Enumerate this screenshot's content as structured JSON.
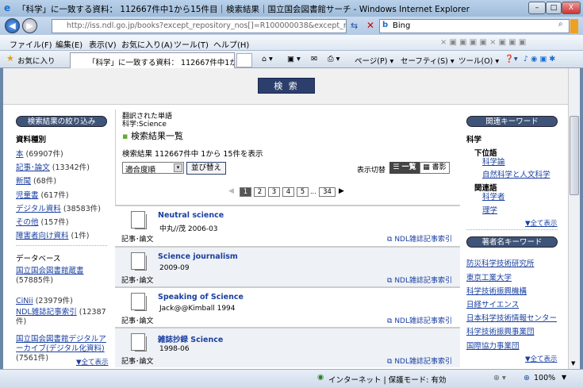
{
  "window": {
    "title": "「科学」に一致する資料： 112667件中1から15件目｜検索結果｜国立国会図書館サーチ - Windows Internet Explorer",
    "minimize": "–",
    "maximize": "□",
    "close": "X"
  },
  "address": {
    "url": "http://iss.ndl.go.jp/books?except_repository_nos[]=R100000038&except_reposito",
    "search_placeholder": "Bing"
  },
  "menu": [
    "ファイル(F)",
    "編集(E)",
    "表示(V)",
    "お気に入り(A)",
    "ツール(T)",
    "ヘルプ(H)"
  ],
  "favorites": {
    "label": "お気に入り",
    "tab": "「科学」に一致する資料： 112667件中1から1...",
    "tools": [
      "ページ(P) ▾",
      "セーフティ(S) ▾",
      "ツール(O) ▾"
    ]
  },
  "search_button": "検 索",
  "left": {
    "header": "検索結果の絞り込み",
    "type_title": "資料種別",
    "types": [
      {
        "label": "本",
        "count": "(69907件)"
      },
      {
        "label": "記事･論文",
        "count": "(13342件)"
      },
      {
        "label": "新聞",
        "count": "(68件)"
      },
      {
        "label": "児童書",
        "count": "(617件)"
      },
      {
        "label": "デジタル資料",
        "count": "(38583件)"
      },
      {
        "label": "その他",
        "count": "(157件)"
      },
      {
        "label": "障害者向け資料",
        "count": "(1件)"
      }
    ],
    "db_title": "データベース",
    "dbs": [
      {
        "label": "国立国会図書館蔵書",
        "count": "(57885件)"
      },
      {
        "label": "CiNii",
        "count": "(23979件)"
      },
      {
        "label": "NDL雑誌記事索引",
        "count": "(12387件)"
      },
      {
        "label": "国立国会図書館デジタルアーカイブ(デジタル化資料)",
        "count": "(7561件)"
      }
    ],
    "show_all": "▼全て表示"
  },
  "main": {
    "translated_label": "翻訳された単語",
    "translated_value": "科学:Science",
    "heading": "検索結果一覧",
    "summary": "検索結果 112667件中 1から 15件を表示",
    "sort_value": "適合度順",
    "sort_button": "並び替え",
    "view_label": "表示切替",
    "view_list": "一覧",
    "view_cover": "書影",
    "pages": [
      "1",
      "2",
      "3",
      "4",
      "5",
      "...",
      "34"
    ],
    "results": [
      {
        "type": "記事･論文",
        "title": "Neutral science",
        "meta": "中丸//茂  2006-03",
        "source": "NDL雑誌記事索引"
      },
      {
        "type": "記事･論文",
        "title": "Science journalism",
        "meta": "2009-09",
        "source": "NDL雑誌記事索引"
      },
      {
        "type": "記事･論文",
        "title": "Speaking of Science",
        "meta": "Jack@@Kimball  1994",
        "source": "NDL雑誌記事索引"
      },
      {
        "type": "記事･論文",
        "title": "雑誌抄録 Science",
        "meta": "1998-06",
        "source": "NDL雑誌記事索引"
      }
    ]
  },
  "right": {
    "header": "関連キーワード",
    "term": "科学",
    "narrower_label": "下位語",
    "narrower": [
      "科学論",
      "自然科学と人文科学"
    ],
    "related_label": "関連語",
    "related": [
      "科学者",
      "理学"
    ],
    "show_all": "▼全て表示",
    "author_header": "著者名キーワード",
    "authors": [
      "防災科学技術研究所",
      "東京工業大学",
      "科学技術振興機構",
      "日経サイエンス",
      "日本科学技術情報センター",
      "科学技術振興事業団",
      "国際協力事業団"
    ],
    "author_show_all": "▼全て表示"
  },
  "status": {
    "zone": "インターネット | 保護モード: 有効",
    "zoom": "100%"
  }
}
